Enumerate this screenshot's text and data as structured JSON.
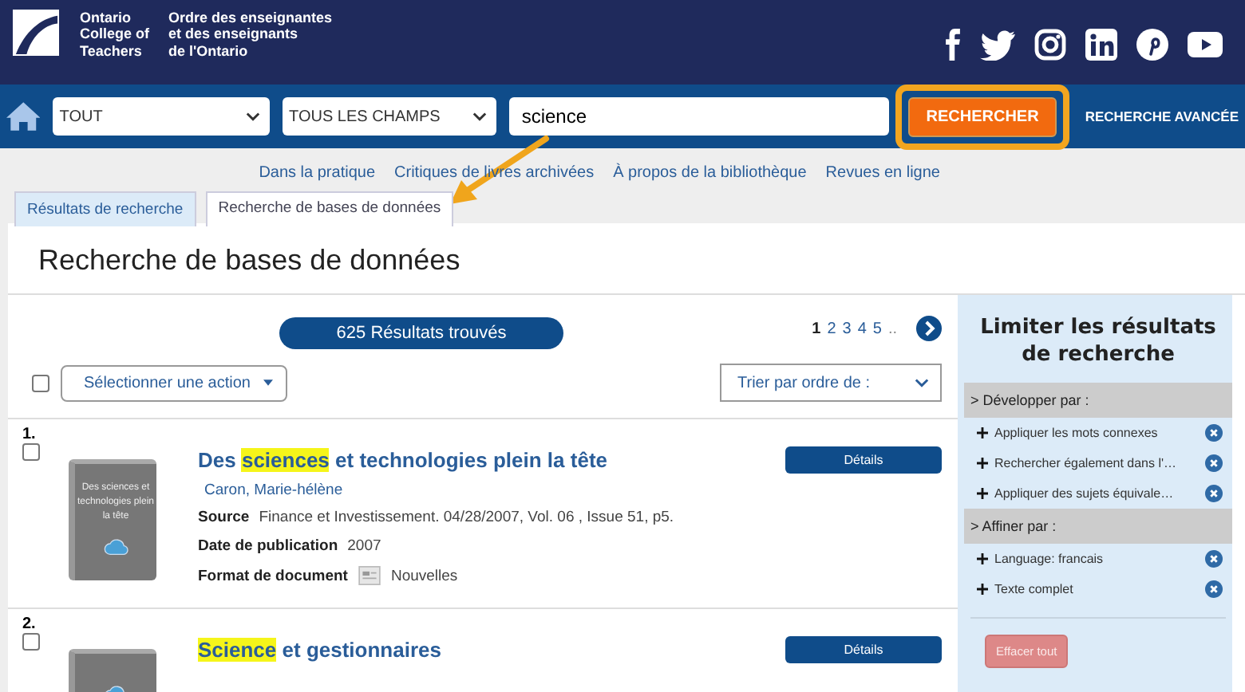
{
  "header": {
    "logo_en": [
      "Ontario",
      "College of",
      "Teachers"
    ],
    "logo_fr": [
      "Ordre des enseignantes",
      "et des enseignants",
      "de l'Ontario"
    ]
  },
  "search": {
    "scope": "TOUT",
    "field": "TOUS LES CHAMPS",
    "query": "science",
    "button": "RECHERCHER",
    "advanced": "RECHERCHE AVANCÉE",
    "button_highlighted": true
  },
  "links": [
    "Dans la pratique",
    "Critiques de livres archivées",
    "À propos de la bibliothèque",
    "Revues en ligne"
  ],
  "tabs": [
    {
      "label": "Résultats de recherche",
      "selected": false
    },
    {
      "label": "Recherche de bases de données",
      "selected": true
    }
  ],
  "page_title": "Recherche de bases de données",
  "results_count": "625 Résultats trouvés",
  "pagination": {
    "pages": [
      {
        "label": "1",
        "selected": true
      },
      {
        "label": "2",
        "selected": false
      },
      {
        "label": "3",
        "selected": false
      },
      {
        "label": "4",
        "selected": false
      },
      {
        "label": "5",
        "selected": false
      }
    ],
    "more": ".."
  },
  "select_all": {
    "checked": false
  },
  "action_select": "Sélectionner une action",
  "sort_select": "Trier par ordre de :",
  "results": [
    {
      "number": "1.",
      "checked": false,
      "cover_text": "Des sciences et technologies plein la tête",
      "title": [
        {
          "text": "Des ",
          "highlight": false
        },
        {
          "text": "sciences",
          "highlight": true
        },
        {
          "text": " et technologies plein la tête",
          "highlight": false
        }
      ],
      "author": "Caron, Marie-hélène",
      "fields": [
        {
          "label": "Source",
          "value": "Finance et Investissement. 04/28/2007, Vol. 06 , Issue 51, p5.",
          "kind": "text"
        },
        {
          "label": "Date de publication",
          "value": "2007",
          "kind": "text"
        },
        {
          "label": "Format de document",
          "value": "Nouvelles",
          "kind": "format"
        }
      ],
      "button": "Détails"
    },
    {
      "number": "2.",
      "checked": false,
      "title": [
        {
          "text": "Science",
          "highlight": true
        },
        {
          "text": " et gestionnaires",
          "highlight": false
        }
      ],
      "button": "Détails"
    }
  ],
  "sidebar": {
    "title": "Limiter les résultats de recherche",
    "sections": [
      {
        "heading": "> Développer par :",
        "items": [
          "Appliquer les mots connexes",
          "Rechercher également dans l'…",
          "Appliquer des sujets équivale…"
        ]
      },
      {
        "heading": "> Affiner par :",
        "items": [
          "Language: francais",
          "Texte complet"
        ]
      }
    ],
    "clear": "Effacer tout"
  }
}
